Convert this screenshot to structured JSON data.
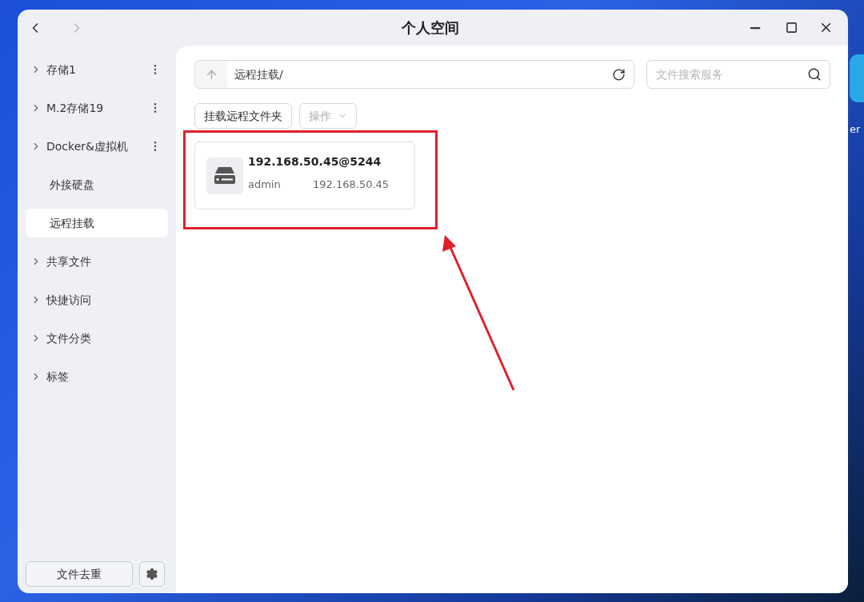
{
  "desktop": {
    "icon_label": "er"
  },
  "window": {
    "title": "个人空间"
  },
  "sidebar": {
    "items": [
      {
        "label": "存储1",
        "expandable": true,
        "menu": true,
        "selected": false
      },
      {
        "label": "M.2存储19",
        "expandable": true,
        "menu": true,
        "selected": false
      },
      {
        "label": "Docker&虚拟机",
        "expandable": true,
        "menu": true,
        "selected": false
      },
      {
        "label": "外接硬盘",
        "expandable": false,
        "menu": false,
        "selected": false
      },
      {
        "label": "远程挂载",
        "expandable": false,
        "menu": false,
        "selected": true
      },
      {
        "label": "共享文件",
        "expandable": true,
        "menu": false,
        "selected": false
      },
      {
        "label": "快捷访问",
        "expandable": true,
        "menu": false,
        "selected": false
      },
      {
        "label": "文件分类",
        "expandable": true,
        "menu": false,
        "selected": false
      },
      {
        "label": "标签",
        "expandable": true,
        "menu": false,
        "selected": false
      }
    ],
    "dedupe_button": "文件去重"
  },
  "path_bar": {
    "value": "远程挂载/"
  },
  "search": {
    "placeholder": "文件搜索服务"
  },
  "toolbar": {
    "mount_button": "挂载远程文件夹",
    "actions_button": {
      "label": "操作",
      "disabled": true
    }
  },
  "mounts": [
    {
      "name": "192.168.50.45@5244",
      "user": "admin",
      "host": "192.168.50.45"
    }
  ]
}
